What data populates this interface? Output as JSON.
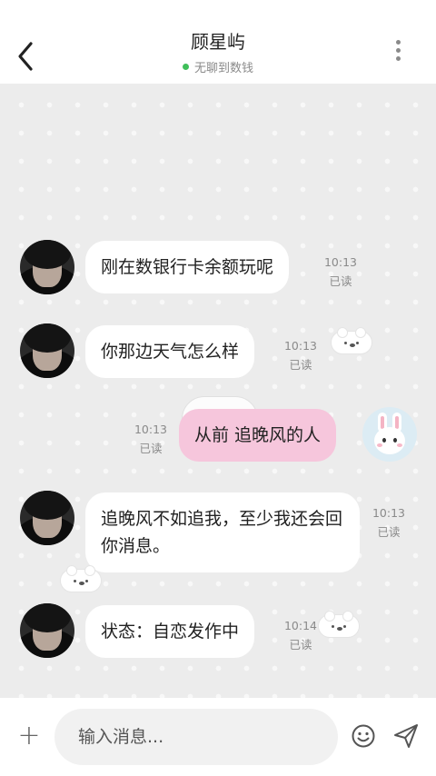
{
  "header": {
    "title": "顾星屿",
    "status": "无聊到数钱",
    "status_color": "#3fbf5a",
    "back_icon": "chevron-left-icon",
    "more_icon": "more-vertical-icon"
  },
  "messages": [
    {
      "sender": "contact",
      "text": "刚在数银行卡余额玩呢",
      "time": "10:13",
      "read": "已读"
    },
    {
      "sender": "contact",
      "text": "你那边天气怎么样",
      "time": "10:13",
      "read": "已读"
    },
    {
      "sender": "me",
      "text": "从前 追晚风的人",
      "time": "10:13",
      "read": "已读"
    },
    {
      "sender": "contact",
      "text": "追晚风不如追我，至少我还会回你消息。",
      "time": "10:13",
      "read": "已读"
    },
    {
      "sender": "contact",
      "text": "状态：自恋发作中",
      "time": "10:14",
      "read": "已读"
    }
  ],
  "composer": {
    "placeholder": "输入消息...",
    "plus_label": "+",
    "emoji_icon": "smiley-icon",
    "send_icon": "send-icon"
  },
  "colors": {
    "my_bubble": "#f6c6dc",
    "their_bubble": "#ffffff",
    "chat_background": "#ececec"
  }
}
